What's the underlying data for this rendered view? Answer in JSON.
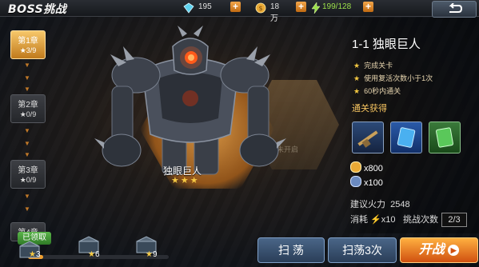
{
  "header": {
    "title": "BOSS挑战",
    "resources": [
      {
        "name": "diamond",
        "icon": "diamond-icon",
        "value": "195"
      },
      {
        "name": "gold",
        "icon": "gold-coin-icon",
        "value": "18万"
      },
      {
        "name": "stamina",
        "icon": "lightning-icon",
        "value": "199/128"
      }
    ]
  },
  "chapters": [
    {
      "label": "第1章",
      "stars": "3/9",
      "state": "active"
    },
    {
      "label": "第2章",
      "stars": "0/9",
      "state": "locked"
    },
    {
      "label": "第3章",
      "stars": "0/9",
      "state": "locked"
    },
    {
      "label": "第4章",
      "stars": "",
      "state": "locked"
    }
  ],
  "boss": {
    "name": "独眼巨人",
    "stars": "★★★",
    "next_locked_label": "未开启"
  },
  "stage": {
    "title": "1-1 独眼巨人",
    "conditions": [
      "完成关卡",
      "使用复活次数小于1次",
      "60秒内通关"
    ],
    "rewards_label": "通关获得",
    "rewards": [
      {
        "name": "weapon-rifle",
        "icon": "rifle-icon"
      },
      {
        "name": "blue-card",
        "icon": "card-icon"
      },
      {
        "name": "exp-card",
        "icon": "exp-card-icon"
      }
    ],
    "gold_reward": "x800",
    "exp_reward": "x100",
    "firepower_label": "建议火力",
    "firepower_value": "2548",
    "consume_label": "消耗",
    "consume_value": "x10",
    "tries_label": "挑战次数",
    "tries_value": "2/3"
  },
  "star_boxes": {
    "claimed_label": "已领取",
    "boxes": [
      {
        "stars": "3"
      },
      {
        "stars": "6"
      },
      {
        "stars": "9"
      }
    ],
    "progress": 0.11
  },
  "buttons": {
    "sweep": "扫 荡",
    "sweep3": "扫荡3次",
    "start": "开战"
  },
  "colors": {
    "accent": "#f0a030",
    "gold": "#f4c842"
  }
}
